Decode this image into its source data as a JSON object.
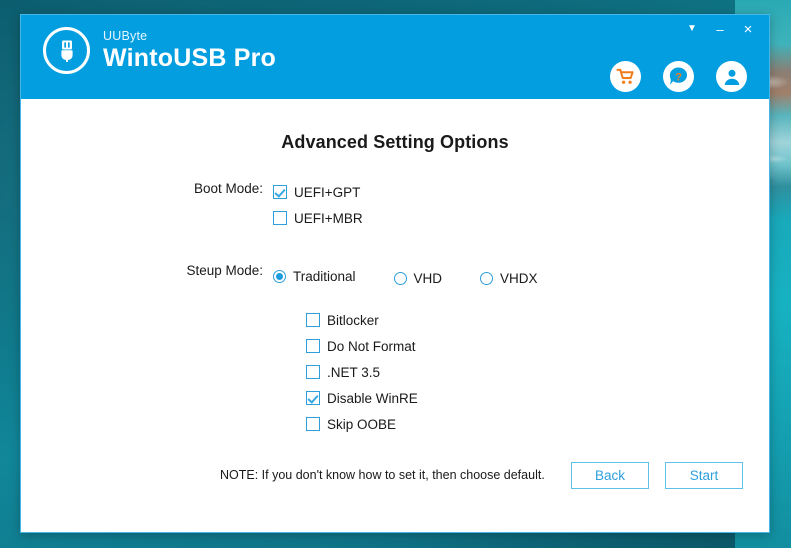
{
  "desktop": {
    "wallpaper_tint": "#0f7488"
  },
  "window": {
    "accent_color": "#029ee0",
    "brand": {
      "company": "UUByte",
      "product": "WintoUSB Pro",
      "logo_icon": "usb-drive-icon"
    },
    "controls": {
      "caret": "▼",
      "minimize": "–",
      "close": "×"
    },
    "header_icons": [
      {
        "name": "cart-icon",
        "color": "#f07d1a"
      },
      {
        "name": "help-icon",
        "color": "#f07d1a"
      },
      {
        "name": "account-icon",
        "color": "#029ee0"
      }
    ]
  },
  "main": {
    "title": "Advanced Setting Options",
    "boot_mode": {
      "label": "Boot Mode:",
      "options": [
        {
          "label": "UEFI+GPT",
          "checked": true
        },
        {
          "label": "UEFI+MBR",
          "checked": false
        }
      ]
    },
    "setup_mode": {
      "label": "Steup Mode:",
      "options": [
        {
          "label": "Traditional",
          "selected": true
        },
        {
          "label": "VHD",
          "selected": false
        },
        {
          "label": "VHDX",
          "selected": false
        }
      ]
    },
    "extras": [
      {
        "label": "Bitlocker",
        "checked": false
      },
      {
        "label": "Do Not Format",
        "checked": false
      },
      {
        "label": ".NET 3.5",
        "checked": false
      },
      {
        "label": "Disable WinRE",
        "checked": true
      },
      {
        "label": "Skip OOBE",
        "checked": false
      }
    ],
    "note": "NOTE: If you don't know how to set it, then choose default.",
    "buttons": {
      "back": "Back",
      "start": "Start"
    }
  }
}
